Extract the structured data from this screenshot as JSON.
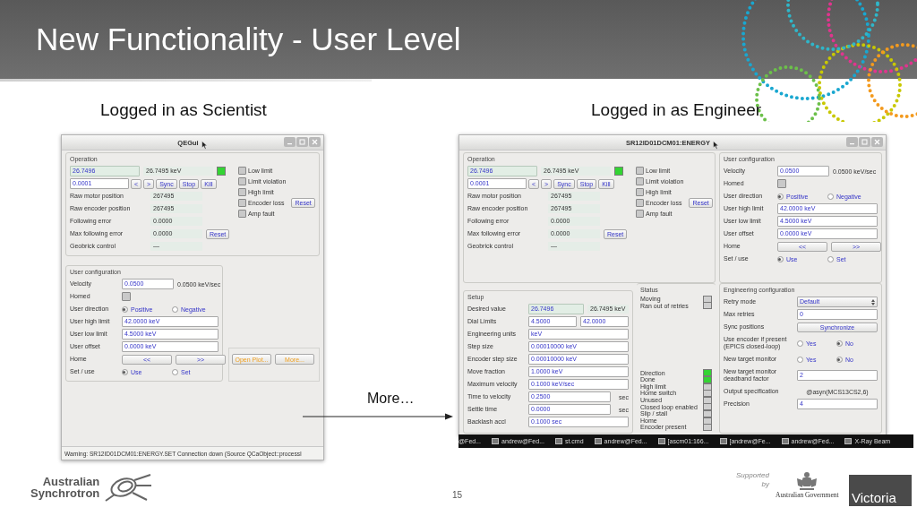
{
  "slide": {
    "title": "New Functionality - User Level",
    "captions": [
      "Logged in as Scientist",
      "Logged in as Engineer"
    ],
    "callout": "More…",
    "page_number": "15"
  },
  "left_window": {
    "title": "QEGui",
    "operation": {
      "label": "Operation",
      "setpoint": "26.7496",
      "readback": "26.7495 keV",
      "in_position": true,
      "step": "0.0001",
      "controls": [
        "<",
        ">",
        "Sync",
        "Stop",
        "Kill"
      ],
      "rows": [
        {
          "label": "Raw motor position",
          "value": "267495"
        },
        {
          "label": "Raw encoder position",
          "value": "267495"
        },
        {
          "label": "Following error",
          "value": "0.0000"
        },
        {
          "label": "Max following error",
          "value": "0.0000",
          "button": "Reset"
        },
        {
          "label": "Geobrick control",
          "value": "—"
        }
      ],
      "flags": [
        {
          "label": "Low limit",
          "on": false
        },
        {
          "label": "Limit violation",
          "on": false
        },
        {
          "label": "High limit",
          "on": false
        },
        {
          "label": "Encoder loss",
          "on": false,
          "button": "Reset"
        },
        {
          "label": "Amp fault",
          "on": false
        }
      ]
    },
    "user_config": {
      "label": "User configuration",
      "rows": [
        {
          "kind": "readback",
          "label": "Velocity",
          "value": "0.0500",
          "readback": "0.0500 keV/sec"
        },
        {
          "kind": "check",
          "label": "Homed",
          "checked": false
        },
        {
          "kind": "radio",
          "label": "User direction",
          "options": [
            {
              "label": "Positive",
              "selected": true
            },
            {
              "label": "Negative",
              "selected": false
            }
          ]
        },
        {
          "kind": "field",
          "label": "User high limit",
          "value": "42.0000 keV"
        },
        {
          "kind": "field",
          "label": "User low limit",
          "value": "4.5000 keV"
        },
        {
          "kind": "field",
          "label": "User offset",
          "value": "0.0000 keV"
        },
        {
          "kind": "buttons",
          "label": "Home",
          "buttons": [
            "<<",
            ">>"
          ]
        },
        {
          "kind": "radio",
          "label": "Set / use",
          "options": [
            {
              "label": "Use",
              "selected": true
            },
            {
              "label": "Set",
              "selected": false
            }
          ]
        }
      ]
    },
    "actions": [
      "Open Plot...",
      "More..."
    ],
    "status_message": "Warning: SR12ID01DCM01:ENERGY.SET Connection down (Source QCaObject::processI"
  },
  "right_window": {
    "title": "SR12ID01DCM01:ENERGY",
    "operation": {
      "label": "Operation",
      "setpoint": "26.7496",
      "readback": "26.7495 keV",
      "in_position": true,
      "step": "0.0001",
      "controls": [
        "<",
        ">",
        "Sync",
        "Stop",
        "Kill"
      ],
      "rows": [
        {
          "label": "Raw motor position",
          "value": "267495"
        },
        {
          "label": "Raw encoder position",
          "value": "267495"
        },
        {
          "label": "Following error",
          "value": "0.0000"
        },
        {
          "label": "Max following error",
          "value": "0.0000",
          "button": "Reset"
        },
        {
          "label": "Geobrick control",
          "value": "—"
        }
      ],
      "flags": [
        {
          "label": "Low limit",
          "on": false
        },
        {
          "label": "Limit violation",
          "on": false
        },
        {
          "label": "High limit",
          "on": false
        },
        {
          "label": "Encoder loss",
          "on": false,
          "button": "Reset"
        },
        {
          "label": "Amp fault",
          "on": false
        }
      ]
    },
    "user_config": {
      "label": "User configuration",
      "rows": [
        {
          "kind": "readback",
          "label": "Velocity",
          "value": "0.0500",
          "readback": "0.0500 keV/sec"
        },
        {
          "kind": "check",
          "label": "Homed",
          "checked": false
        },
        {
          "kind": "radio",
          "label": "User direction",
          "options": [
            {
              "label": "Positive",
              "selected": true
            },
            {
              "label": "Negative",
              "selected": false
            }
          ]
        },
        {
          "kind": "field",
          "label": "User high limit",
          "value": "42.0000 keV"
        },
        {
          "kind": "field",
          "label": "User low limit",
          "value": "4.5000 keV"
        },
        {
          "kind": "field",
          "label": "User offset",
          "value": "0.0000 keV"
        },
        {
          "kind": "buttons",
          "label": "Home",
          "buttons": [
            "<<",
            ">>"
          ]
        },
        {
          "kind": "radio",
          "label": "Set / use",
          "options": [
            {
              "label": "Use",
              "selected": true
            },
            {
              "label": "Set",
              "selected": false
            }
          ]
        }
      ]
    },
    "setup": {
      "label": "Setup",
      "rows": [
        {
          "kind": "setpoint",
          "label": "Desired value",
          "value": "26.7496",
          "readback": "26.7495 keV"
        },
        {
          "kind": "pair",
          "label": "Dial Limits",
          "values": [
            "4.5000",
            "42.0000"
          ]
        },
        {
          "kind": "field",
          "label": "Engineering units",
          "value": "keV"
        },
        {
          "kind": "field",
          "label": "Step size",
          "value": "0.00010000 keV"
        },
        {
          "kind": "field",
          "label": "Encoder step size",
          "value": "0.00010000 keV"
        },
        {
          "kind": "field",
          "label": "Move fraction",
          "value": "1.0000 keV"
        },
        {
          "kind": "field",
          "label": "Maximum velocity",
          "value": "0.1000 keV/sec"
        },
        {
          "kind": "field",
          "label": "Time to velocity",
          "value": "0.2500",
          "unit": "sec"
        },
        {
          "kind": "field",
          "label": "Settle time",
          "value": "0.0000",
          "unit": "sec"
        },
        {
          "kind": "field",
          "label": "Backlash accl",
          "value": "0.1000 sec"
        }
      ]
    },
    "status": {
      "label": "Status",
      "groups": [
        {
          "items": [
            {
              "label": "Moving",
              "on": false
            },
            {
              "label": "Ran out of retries",
              "on": false
            }
          ]
        },
        {
          "items": [
            {
              "label": "Direction",
              "on": true
            },
            {
              "label": "Done",
              "on": true
            },
            {
              "label": "High limit",
              "on": false
            },
            {
              "label": "Home switch",
              "on": false
            },
            {
              "label": "Unused",
              "on": false
            },
            {
              "label": "Closed loop enabled",
              "on": false
            },
            {
              "label": "Slip / stall",
              "on": false
            },
            {
              "label": "Home",
              "on": false
            },
            {
              "label": "Encoder present",
              "on": false
            }
          ]
        }
      ]
    },
    "engineering": {
      "label": "Engineering configuration",
      "rows": [
        {
          "kind": "select",
          "label": "Retry mode",
          "value": "Default"
        },
        {
          "kind": "field",
          "label": "Max retries",
          "value": "0"
        },
        {
          "kind": "button",
          "label": "Sync positions",
          "button": "Synchronize"
        },
        {
          "kind": "radio",
          "label": "Use encoder if present (EPICS closed-loop)",
          "options": [
            {
              "label": "Yes",
              "selected": false
            },
            {
              "label": "No",
              "selected": true
            }
          ]
        },
        {
          "kind": "radio",
          "label": "New target monitor",
          "options": [
            {
              "label": "Yes",
              "selected": false
            },
            {
              "label": "No",
              "selected": true
            }
          ]
        },
        {
          "kind": "field",
          "label": "New target monitor deadband factor",
          "value": "2"
        },
        {
          "kind": "text",
          "label": "Output specification",
          "value": "@asyn(MCS13CS2,6)"
        },
        {
          "kind": "field",
          "label": "Precision",
          "value": "4"
        }
      ]
    }
  },
  "taskbar": {
    "items": [
      {
        "kind": "label",
        "label": "@Fed..."
      },
      {
        "kind": "window",
        "label": "andrew@Fed..."
      },
      {
        "kind": "window",
        "label": "st.cmd"
      },
      {
        "kind": "window",
        "label": "andrew@Fed..."
      },
      {
        "kind": "window",
        "label": "[ascm01:166..."
      },
      {
        "kind": "window",
        "label": "[andrew@Fe..."
      },
      {
        "kind": "window",
        "label": "andrew@Fed..."
      },
      {
        "kind": "window",
        "label": "X-Ray Beam"
      }
    ]
  },
  "footer": {
    "logo_lines": [
      "Australian",
      "Synchrotron"
    ],
    "supported": [
      "Supported",
      "by"
    ],
    "government": "Australian Government",
    "victoria": "Victoria"
  }
}
